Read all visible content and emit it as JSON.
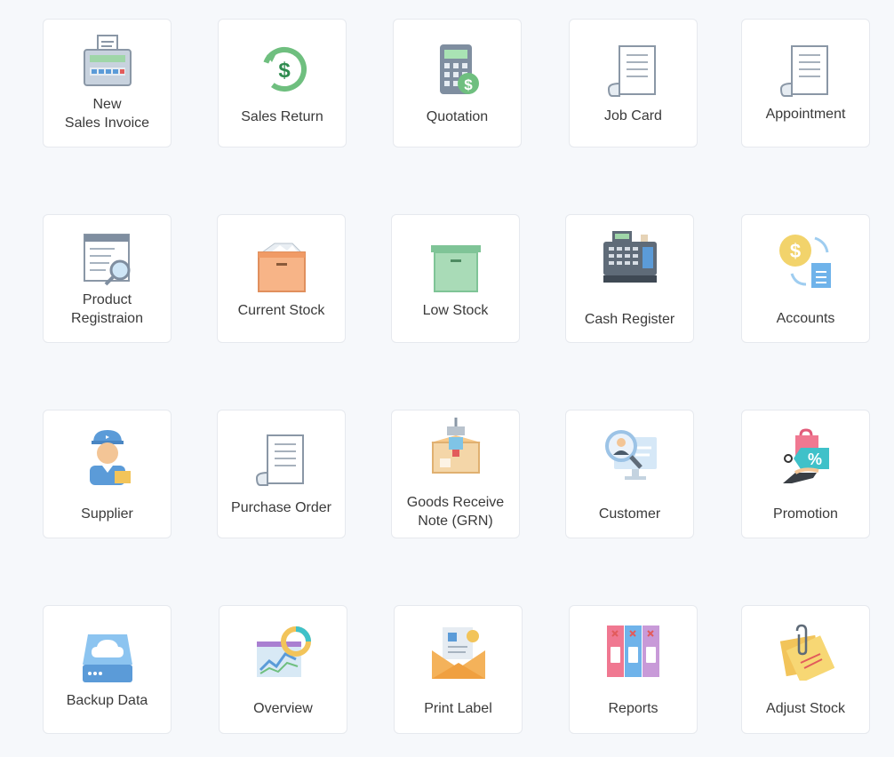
{
  "tiles": [
    {
      "label": "New\nSales Invoice",
      "icon": "cash-register-invoice-icon"
    },
    {
      "label": "Sales Return",
      "icon": "refund-dollar-icon"
    },
    {
      "label": "Quotation",
      "icon": "calculator-dollar-icon"
    },
    {
      "label": "Job Card",
      "icon": "receipt-paper-icon"
    },
    {
      "label": "Appointment",
      "icon": "receipt-paper-icon"
    },
    {
      "label": "Product\nRegistraion",
      "icon": "document-search-icon"
    },
    {
      "label": "Current Stock",
      "icon": "open-box-icon"
    },
    {
      "label": "Low Stock",
      "icon": "green-box-icon"
    },
    {
      "label": "Cash Register",
      "icon": "cash-register-icon"
    },
    {
      "label": "Accounts",
      "icon": "dollar-document-exchange-icon"
    },
    {
      "label": "Supplier",
      "icon": "delivery-man-icon"
    },
    {
      "label": "Purchase Order",
      "icon": "receipt-paper-icon"
    },
    {
      "label": "Goods Receive\nNote (GRN)",
      "icon": "crane-box-icon"
    },
    {
      "label": "Customer",
      "icon": "user-search-monitor-icon"
    },
    {
      "label": "Promotion",
      "icon": "discount-tag-bag-icon"
    },
    {
      "label": "Backup Data",
      "icon": "cloud-drive-icon"
    },
    {
      "label": "Overview",
      "icon": "analytics-chart-icon"
    },
    {
      "label": "Print Label",
      "icon": "envelope-label-icon"
    },
    {
      "label": "Reports",
      "icon": "binders-icon"
    },
    {
      "label": "Adjust Stock",
      "icon": "sticky-notes-clip-icon"
    }
  ]
}
